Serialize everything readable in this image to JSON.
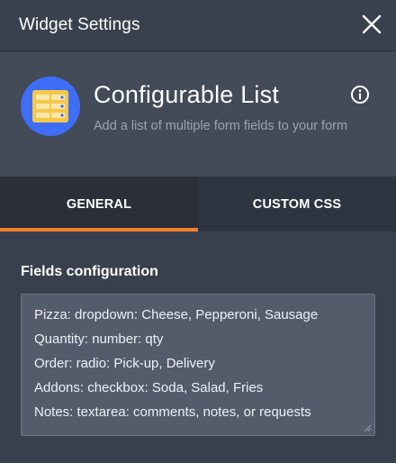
{
  "dialog": {
    "title": "Widget Settings",
    "close_icon": "close-icon"
  },
  "widget": {
    "name": "Configurable List",
    "description": "Add a list of multiple form fields to your form",
    "icon": "list-form-icon",
    "info_icon": "info-icon",
    "colors": {
      "icon_bg": "#3e6ef5",
      "icon_fg": "#f5c84b"
    }
  },
  "tabs": [
    {
      "label": "GENERAL",
      "active": true
    },
    {
      "label": "CUSTOM CSS",
      "active": false
    }
  ],
  "accent_color": "#f3802b",
  "fields_config": {
    "label": "Fields configuration",
    "lines": [
      "Pizza: dropdown: Cheese, Pepperoni, Sausage",
      "Quantity: number: qty",
      "Order: radio: Pick-up, Delivery",
      "Addons: checkbox: Soda, Salad, Fries",
      "Notes: textarea: comments, notes, or requests"
    ]
  }
}
